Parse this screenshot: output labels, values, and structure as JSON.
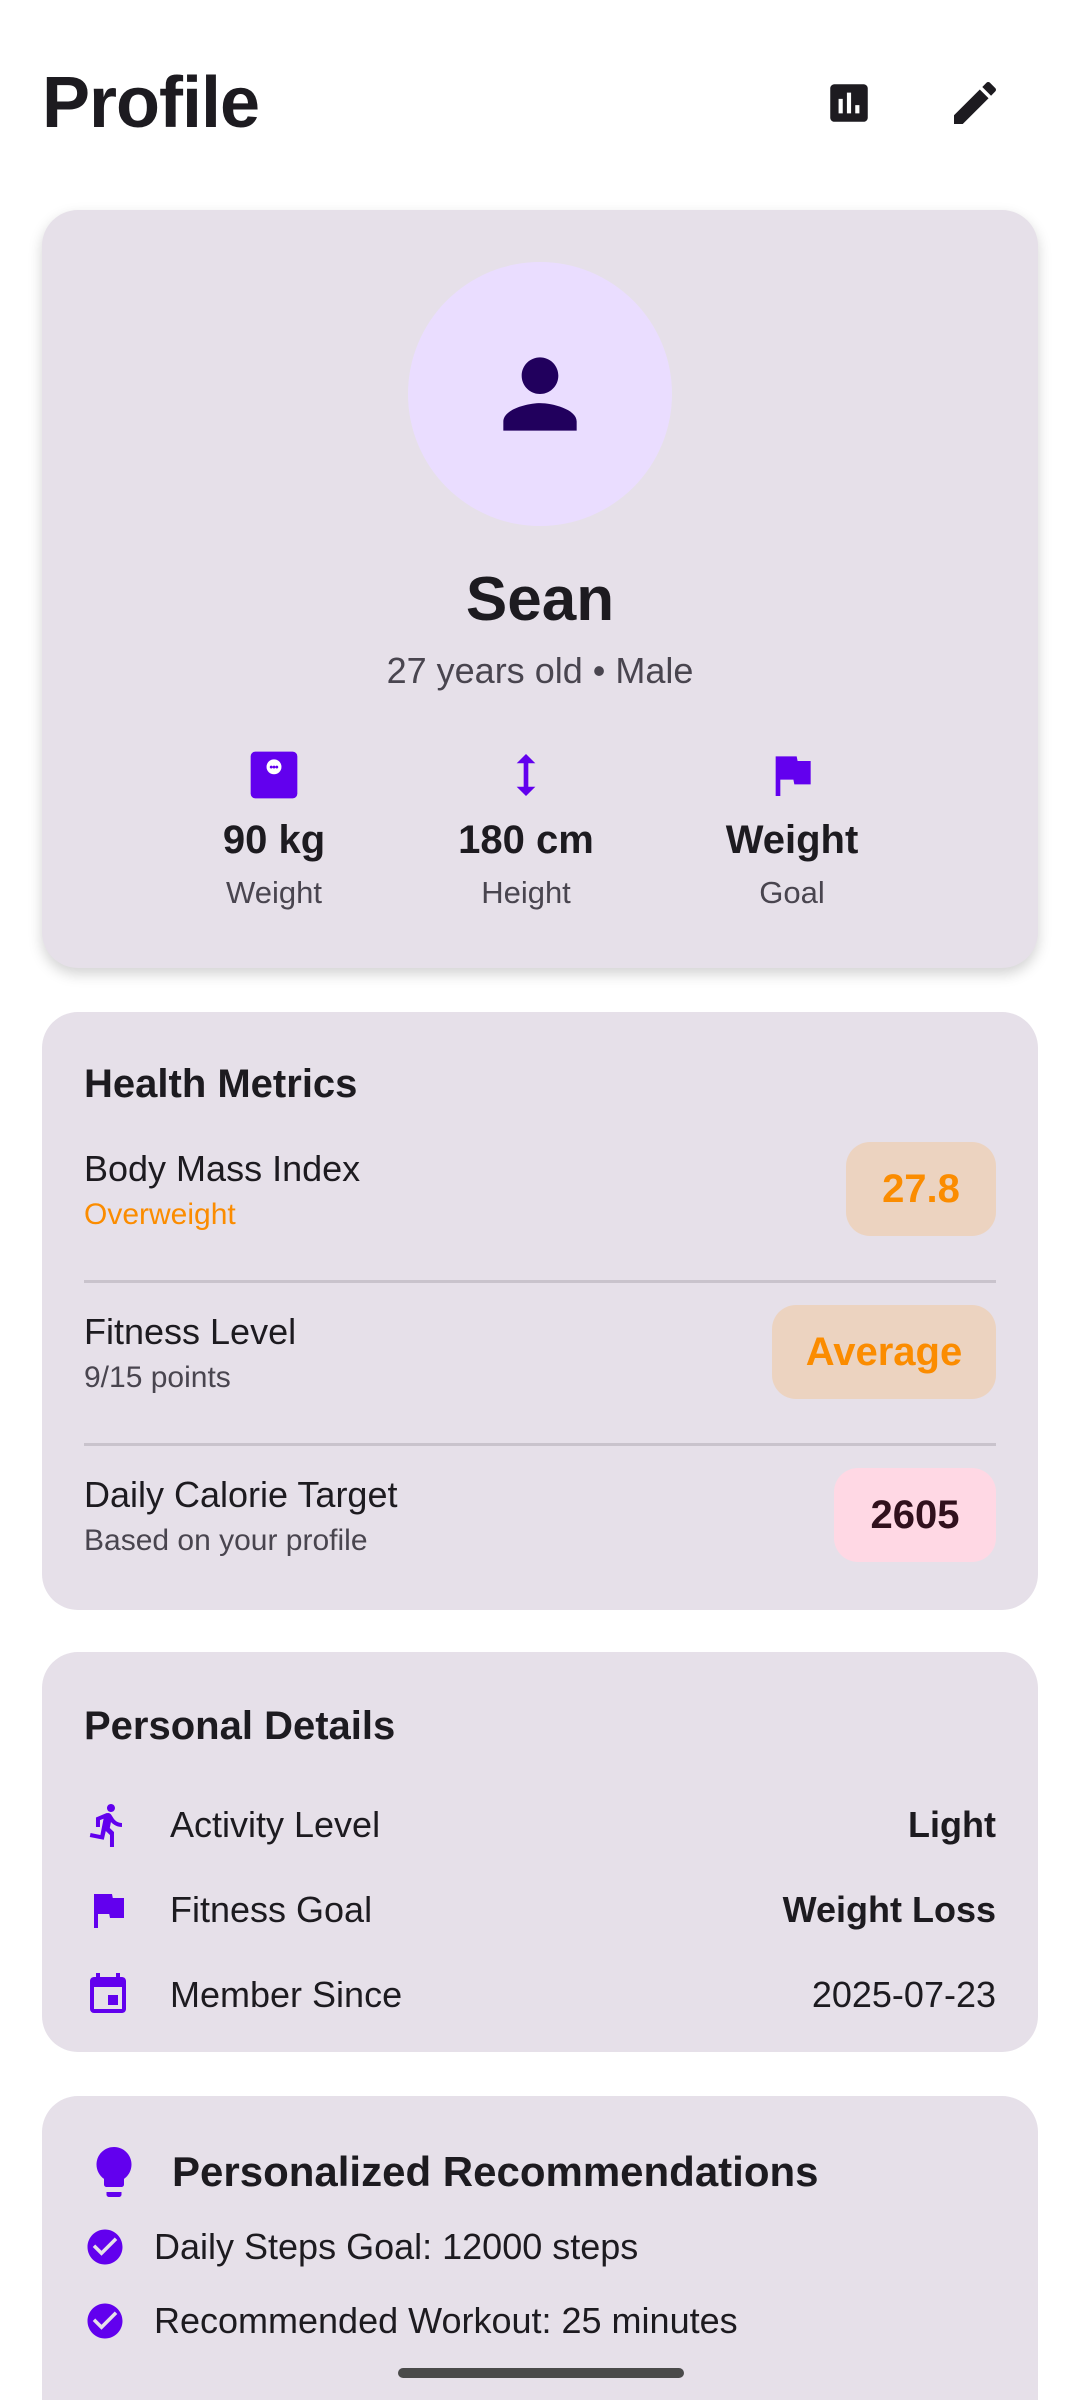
{
  "header": {
    "title": "Profile",
    "stats_icon": "bar-chart-icon",
    "edit_icon": "edit-pencil-icon"
  },
  "profile": {
    "avatar_icon": "person-icon",
    "name": "Sean",
    "subtitle": "27 years old • Male",
    "stats": [
      {
        "icon": "scale-icon",
        "value": "90 kg",
        "label": "Weight"
      },
      {
        "icon": "height-icon",
        "value": "180 cm",
        "label": "Height"
      },
      {
        "icon": "flag-icon",
        "value": "Weight",
        "label": "Goal"
      }
    ]
  },
  "metrics": {
    "title": "Health Metrics",
    "rows": [
      {
        "title": "Body Mass Index",
        "subtitle": "Overweight",
        "value": "27.8"
      },
      {
        "title": "Fitness Level",
        "subtitle": "9/15 points",
        "value": "Average"
      },
      {
        "title": "Daily Calorie Target",
        "subtitle": "Based on your profile",
        "value": "2605"
      }
    ]
  },
  "details": {
    "title": "Personal Details",
    "rows": [
      {
        "icon": "running-icon",
        "label": "Activity Level",
        "value": "Light"
      },
      {
        "icon": "flag-icon",
        "label": "Fitness Goal",
        "value": "Weight Loss"
      },
      {
        "icon": "calendar-icon",
        "label": "Member Since",
        "value": "2025-07-23"
      }
    ]
  },
  "recommendations": {
    "icon": "lightbulb-icon",
    "title": "Personalized Recommendations",
    "items": [
      "Daily Steps Goal: 12000 steps",
      "Recommended Workout: 25 minutes"
    ]
  },
  "colors": {
    "accent": "#6200ee",
    "card_bg": "#e6e0e9",
    "avatar_bg": "#eaddff",
    "warning": "#fb8c00",
    "calorie_chip": "#ffd8e4"
  }
}
